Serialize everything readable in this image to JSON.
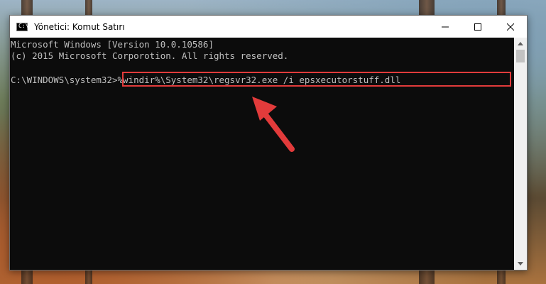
{
  "window": {
    "title": "Yönetici: Komut Satırı",
    "icon": "cmd-icon",
    "icon_text": "C:\\"
  },
  "console": {
    "line1": "Microsoft Windows [Version 10.0.10586]",
    "line2": "(c) 2015 Microsoft Corporotion. All rights reserved.",
    "prompt": "C:\\WINDOWS\\system32>",
    "command": "%windir%\\System32\\regsvr32.exe /i epsxecutorstuff.dll"
  },
  "colors": {
    "console_bg": "#0c0c0c",
    "console_text": "#c0c0c0",
    "highlight": "#e23b3b",
    "arrow": "#e23b3b"
  }
}
